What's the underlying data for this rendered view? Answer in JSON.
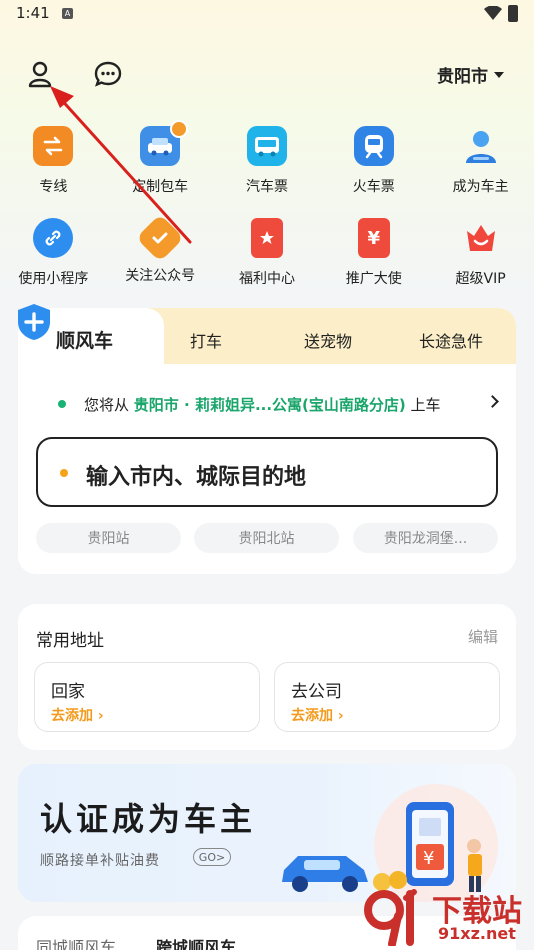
{
  "status_bar": {
    "time": "1:41",
    "sim": "A"
  },
  "header": {
    "city": "贵阳市",
    "profile_icon": "person-icon",
    "message_icon": "chat-icon"
  },
  "services_row1": [
    {
      "label": "专线",
      "icon": "swap-icon",
      "color": "#f08a24"
    },
    {
      "label": "定制包车",
      "icon": "car-crown-icon",
      "color": "#4a90e2"
    },
    {
      "label": "汽车票",
      "icon": "bus-icon",
      "color": "#23b5e8"
    },
    {
      "label": "火车票",
      "icon": "train-icon",
      "color": "#2f84e6"
    },
    {
      "label": "成为车主",
      "icon": "driver-icon",
      "color": "#2e8ae6"
    }
  ],
  "services_row2": [
    {
      "label": "使用小程序",
      "icon": "link-icon",
      "color": "#2d8ef0"
    },
    {
      "label": "关注公众号",
      "icon": "check-badge-icon",
      "color": "#f49a2a"
    },
    {
      "label": "福利中心",
      "icon": "gift-icon",
      "color": "#ef4b3c"
    },
    {
      "label": "推广大使",
      "icon": "yuan-icon",
      "color": "#ef4b3c"
    },
    {
      "label": "超级VIP",
      "icon": "crown-icon",
      "color": "#f0463c"
    }
  ],
  "ride_tabs": [
    "顺风车",
    "打车",
    "送宠物",
    "长途急件"
  ],
  "start": {
    "prefix": "您将从",
    "location": "贵阳市 · 莉莉姐异...公寓(宝山南路分店)",
    "suffix": "上车"
  },
  "destination": {
    "placeholder": "输入市内、城际目的地"
  },
  "chips": [
    "贵阳站",
    "贵阳北站",
    "贵阳龙洞堡..."
  ],
  "addresses": {
    "title": "常用地址",
    "edit": "编辑",
    "items": [
      {
        "name": "回家",
        "action": "去添加"
      },
      {
        "name": "去公司",
        "action": "去添加"
      }
    ]
  },
  "banner": {
    "title": "认证成为车主",
    "subtitle": "顺路接单补贴油费",
    "go": "GO"
  },
  "bottom_tabs": [
    "同城顺风车",
    "跨城顺风车"
  ],
  "watermark": {
    "text": "下载站",
    "url": "91xz.net"
  }
}
